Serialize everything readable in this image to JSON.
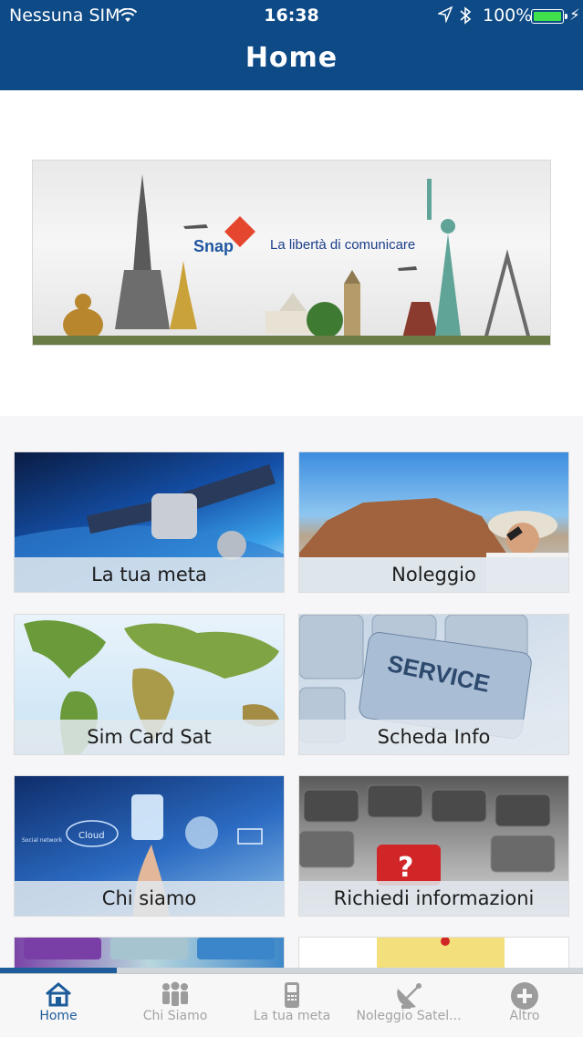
{
  "status_bar": {
    "carrier": "Nessuna SIM",
    "time": "16:38",
    "battery_percent": "100%",
    "battery_level": 1.0,
    "icons": [
      "wifi-icon",
      "location-arrow-icon",
      "bluetooth-icon",
      "battery-icon",
      "charging-bolt-icon"
    ]
  },
  "navbar": {
    "title": "Home"
  },
  "banner": {
    "brand": "Snap",
    "slogan": "La libertà di comunicare"
  },
  "tiles": [
    {
      "label": "La tua meta"
    },
    {
      "label": "Noleggio"
    },
    {
      "label": "Sim Card Sat"
    },
    {
      "label": "Scheda Info"
    },
    {
      "label": "Chi siamo"
    },
    {
      "label": "Richiedi informazioni"
    }
  ],
  "tile_image_text": {
    "service_key": "SERVICE",
    "cloud": "Cloud",
    "social_network": "Social network"
  },
  "scroll_progress": 0.2,
  "tabbar": {
    "active_color": "#1e5b9b",
    "inactive_color": "#a3a3a3",
    "items": [
      {
        "label": "Home",
        "icon": "home-icon",
        "active": true
      },
      {
        "label": "Chi Siamo",
        "icon": "people-icon",
        "active": false
      },
      {
        "label": "La tua meta",
        "icon": "phone-icon",
        "active": false
      },
      {
        "label": "Noleggio Satel...",
        "icon": "satellite-dish-icon",
        "active": false
      },
      {
        "label": "Altro",
        "icon": "plus-circle-icon",
        "active": false
      }
    ]
  },
  "colors": {
    "header_blue": "#0d4a86",
    "battery_green": "#3fe04b"
  }
}
